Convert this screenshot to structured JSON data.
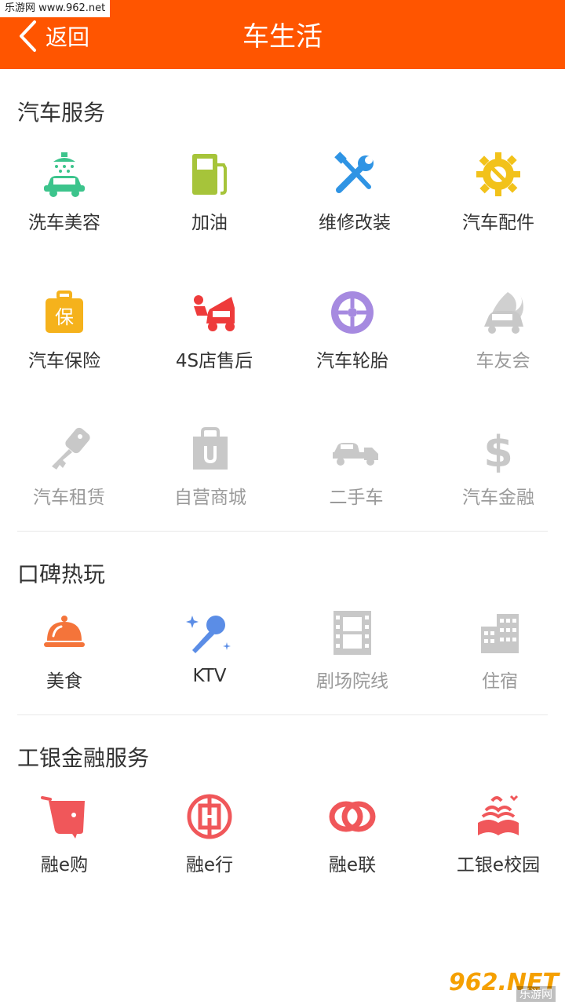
{
  "watermark_top": "乐游网 www.962.net",
  "header": {
    "back_label": "返回",
    "title": "车生活",
    "color": "#ff5500"
  },
  "sections": [
    {
      "title": "汽车服务",
      "items": [
        {
          "label": "洗车美容",
          "icon": "car-wash-icon",
          "color": "#3cc48c"
        },
        {
          "label": "加油",
          "icon": "fuel-pump-icon",
          "color": "#a6c43a"
        },
        {
          "label": "维修改装",
          "icon": "wrench-screwdriver-icon",
          "color": "#2f94e4"
        },
        {
          "label": "汽车配件",
          "icon": "gear-wrench-icon",
          "color": "#f2c21a"
        },
        {
          "label": "汽车保险",
          "icon": "insurance-bag-icon",
          "color": "#f5b21c"
        },
        {
          "label": "4S店售后",
          "icon": "car-repair-icon",
          "color": "#ee3b3b"
        },
        {
          "label": "汽车轮胎",
          "icon": "tire-icon",
          "color": "#a68ae0"
        },
        {
          "label": "车友会",
          "icon": "car-club-icon",
          "color": "#c8c8c8"
        },
        {
          "label": "汽车租赁",
          "icon": "car-key-icon",
          "color": "#c8c8c8"
        },
        {
          "label": "自营商城",
          "icon": "shopping-bag-icon",
          "color": "#c8c8c8"
        },
        {
          "label": "二手车",
          "icon": "tow-truck-icon",
          "color": "#c8c8c8"
        },
        {
          "label": "汽车金融",
          "icon": "dollar-icon",
          "color": "#c8c8c8"
        }
      ]
    },
    {
      "title": "口碑热玩",
      "items": [
        {
          "label": "美食",
          "icon": "food-cloche-icon",
          "color": "#f4743a"
        },
        {
          "label": "KTV",
          "icon": "microphone-icon",
          "color": "#5b8de6"
        },
        {
          "label": "剧场院线",
          "icon": "film-icon",
          "color": "#c8c8c8"
        },
        {
          "label": "住宿",
          "icon": "hotel-building-icon",
          "color": "#c8c8c8"
        }
      ]
    },
    {
      "title": "工银金融服务",
      "items": [
        {
          "label": "融e购",
          "icon": "shopping-cart-icon",
          "color": "#f0575a"
        },
        {
          "label": "融e行",
          "icon": "icbc-logo-icon",
          "color": "#f0575a"
        },
        {
          "label": "融e联",
          "icon": "linked-rings-icon",
          "color": "#f0575a"
        },
        {
          "label": "工银e校园",
          "icon": "open-book-icon",
          "color": "#f0575a"
        }
      ]
    }
  ],
  "watermark_bottom": {
    "big": "962.NET",
    "small": "乐游网"
  }
}
